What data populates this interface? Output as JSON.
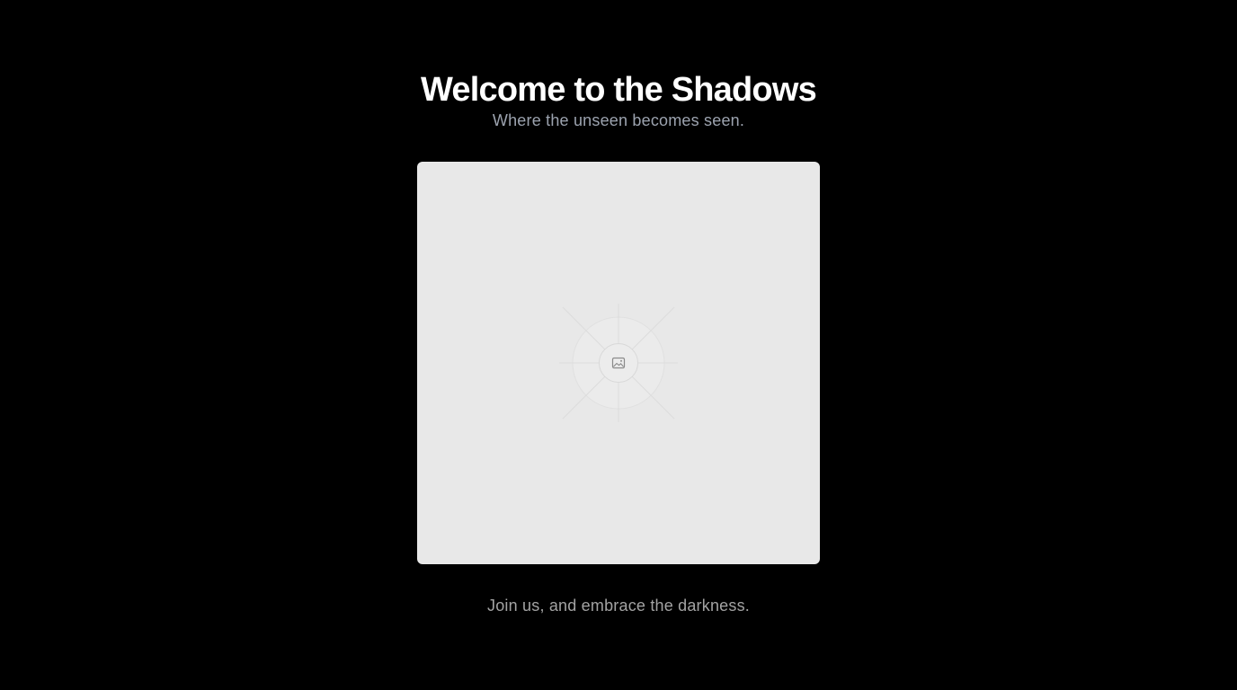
{
  "hero": {
    "title": "Welcome to the Shadows",
    "subtitle": "Where the unseen becomes seen.",
    "closing": "Join us, and embrace the darkness."
  },
  "image_placeholder": {
    "icon": "image-icon",
    "background": "#e8e8e8"
  },
  "colors": {
    "page_background": "#000000",
    "title": "#ffffff",
    "subtitle": "#9ca3af"
  }
}
